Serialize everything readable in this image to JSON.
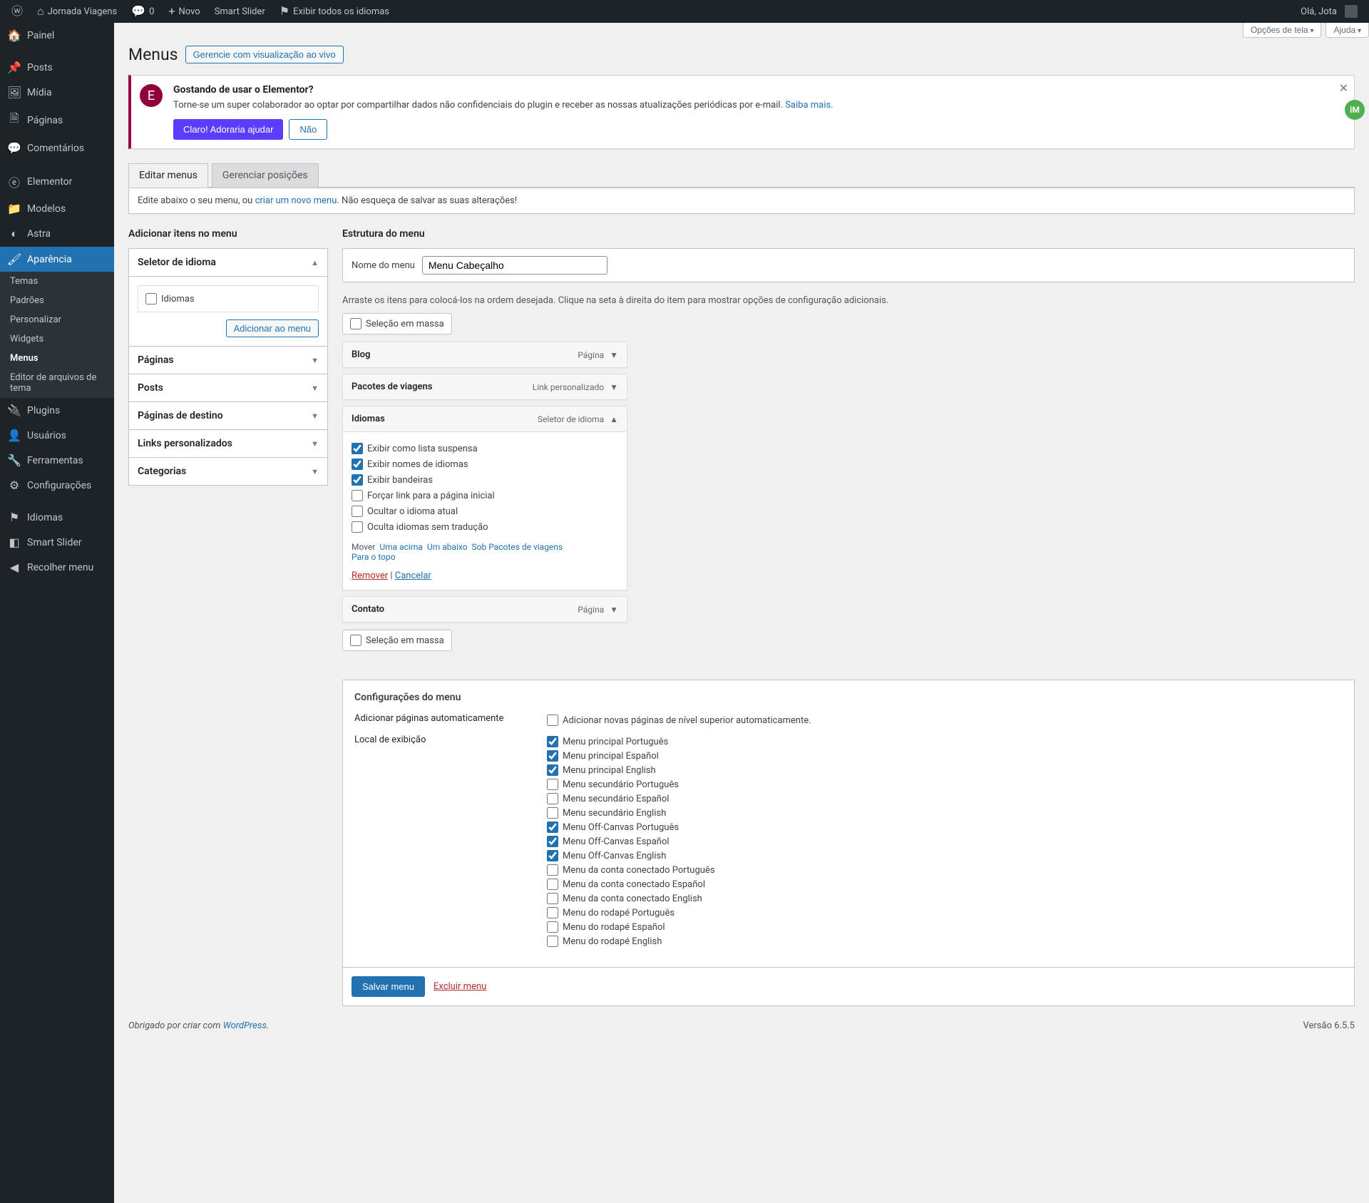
{
  "admin_bar": {
    "site_name": "Jornada Viagens",
    "comments_count": "0",
    "new_label": "Novo",
    "smart_slider": "Smart Slider",
    "show_languages": "Exibir todos os idiomas",
    "greeting": "Olá, Jota"
  },
  "sidebar": {
    "items": [
      {
        "icon": "⌂",
        "label": "Painel"
      },
      {
        "icon": "✎",
        "label": "Posts"
      },
      {
        "icon": "🖼",
        "label": "Mídia"
      },
      {
        "icon": "🗎",
        "label": "Páginas"
      },
      {
        "icon": "💬",
        "label": "Comentários"
      },
      {
        "icon": "ⓔ",
        "label": "Elementor"
      },
      {
        "icon": "📁",
        "label": "Modelos"
      },
      {
        "icon": "◐",
        "label": "Astra"
      },
      {
        "icon": "🖌",
        "label": "Aparência"
      },
      {
        "icon": "🔌",
        "label": "Plugins"
      },
      {
        "icon": "👤",
        "label": "Usuários"
      },
      {
        "icon": "🔧",
        "label": "Ferramentas"
      },
      {
        "icon": "⚙",
        "label": "Configurações"
      },
      {
        "icon": "⚑",
        "label": "Idiomas"
      },
      {
        "icon": "◧",
        "label": "Smart Slider"
      },
      {
        "icon": "◀",
        "label": "Recolher menu"
      }
    ],
    "submenu": [
      {
        "label": "Temas"
      },
      {
        "label": "Padrões"
      },
      {
        "label": "Personalizar"
      },
      {
        "label": "Widgets"
      },
      {
        "label": "Menus"
      },
      {
        "label": "Editor de arquivos de tema"
      }
    ]
  },
  "screen_meta": {
    "options": "Opções de tela",
    "help": "Ajuda"
  },
  "header": {
    "title": "Menus",
    "live_preview_btn": "Gerencie com visualização ao vivo"
  },
  "notice": {
    "heading": "Gostando de usar o Elementor?",
    "text_before": "Torne-se um super colaborador ao optar por compartilhar dados não confidenciais do plugin e receber as nossas atualizações periódicas por e-mail. ",
    "learn_more": "Saiba mais.",
    "yes_btn": "Claro! Adoraria ajudar",
    "no_btn": "Não"
  },
  "tabs": {
    "edit": "Editar menus",
    "manage": "Gerenciar posições"
  },
  "info": {
    "prefix": "Edite abaixo o seu menu, ou ",
    "link": "criar um novo menu",
    "suffix": ". Não esqueça de salvar as suas alterações!"
  },
  "side": {
    "heading": "Adicionar itens no menu",
    "panels": [
      {
        "title": "Seletor de idioma",
        "open": true
      },
      {
        "title": "Páginas",
        "open": false
      },
      {
        "title": "Posts",
        "open": false
      },
      {
        "title": "Páginas de destino",
        "open": false
      },
      {
        "title": "Links personalizados",
        "open": false
      },
      {
        "title": "Categorias",
        "open": false
      }
    ],
    "languages_label": "Idiomas",
    "add_btn": "Adicionar ao menu"
  },
  "structure": {
    "heading": "Estrutura do menu",
    "name_label": "Nome do menu",
    "name_value": "Menu Cabeçalho",
    "hint": "Arraste os itens para colocá-los na ordem desejada. Clique na seta à direita do item para mostrar opções de configuração adicionais.",
    "bulk_label": "Seleção em massa",
    "items": [
      {
        "title": "Blog",
        "type": "Página",
        "open": false
      },
      {
        "title": "Pacotes de viagens",
        "type": "Link personalizado",
        "open": false
      },
      {
        "title": "Idiomas",
        "type": "Seletor de idioma",
        "open": true
      },
      {
        "title": "Contato",
        "type": "Página",
        "open": false
      }
    ],
    "lang_options": [
      {
        "label": "Exibir como lista suspensa",
        "checked": true
      },
      {
        "label": "Exibir nomes de idiomas",
        "checked": true
      },
      {
        "label": "Exibir bandeiras",
        "checked": true
      },
      {
        "label": "Forçar link para a página inicial",
        "checked": false
      },
      {
        "label": "Ocultar o idioma atual",
        "checked": false
      },
      {
        "label": "Oculta idiomas sem tradução",
        "checked": false
      }
    ],
    "move_label": "Mover",
    "move_links": [
      "Uma acima",
      "Um abaixo",
      "Sob Pacotes de viagens",
      "Para o topo"
    ],
    "remove": "Remover",
    "cancel": "Cancelar"
  },
  "settings": {
    "heading": "Configurações do menu",
    "auto_add_label": "Adicionar páginas automaticamente",
    "auto_add_check": "Adicionar novas páginas de nível superior automaticamente.",
    "location_label": "Local de exibição",
    "locations": [
      {
        "label": "Menu principal Português",
        "checked": true
      },
      {
        "label": "Menu principal Español",
        "checked": true
      },
      {
        "label": "Menu principal English",
        "checked": true
      },
      {
        "label": "Menu secundário Português",
        "checked": false
      },
      {
        "label": "Menu secundário Español",
        "checked": false
      },
      {
        "label": "Menu secundário English",
        "checked": false
      },
      {
        "label": "Menu Off-Canvas Português",
        "checked": true
      },
      {
        "label": "Menu Off-Canvas Español",
        "checked": true
      },
      {
        "label": "Menu Off-Canvas English",
        "checked": true
      },
      {
        "label": "Menu da conta conectado Português",
        "checked": false
      },
      {
        "label": "Menu da conta conectado Español",
        "checked": false
      },
      {
        "label": "Menu da conta conectado English",
        "checked": false
      },
      {
        "label": "Menu do rodapé Português",
        "checked": false
      },
      {
        "label": "Menu do rodapé Español",
        "checked": false
      },
      {
        "label": "Menu do rodapé English",
        "checked": false
      }
    ]
  },
  "actions": {
    "save": "Salvar menu",
    "delete": "Excluir menu"
  },
  "footer": {
    "thanks_prefix": "Obrigado por criar com ",
    "wp": "WordPress",
    "version": "Versão 6.5.5"
  }
}
